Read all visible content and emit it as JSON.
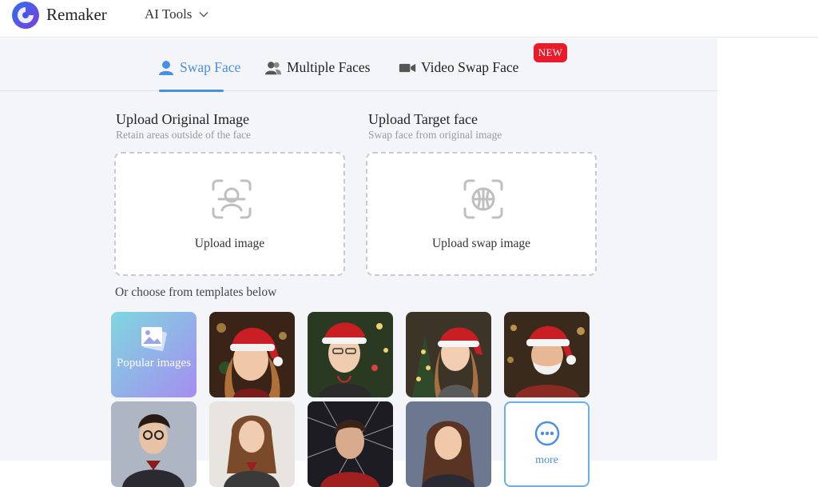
{
  "header": {
    "brand": "Remaker",
    "menu_label": "AI Tools"
  },
  "tabs": [
    {
      "label": "Swap Face",
      "active": true
    },
    {
      "label": "Multiple Faces",
      "active": false
    },
    {
      "label": "Video Swap Face",
      "active": false,
      "badge": "NEW"
    }
  ],
  "original": {
    "title": "Upload Original Image",
    "subtitle": "Retain areas outside of the face",
    "upload_label": "Upload image"
  },
  "target": {
    "title": "Upload Target face",
    "subtitle": "Swap face from original image",
    "upload_label": "Upload swap image"
  },
  "templates": {
    "heading": "Or choose from templates below",
    "popular_label": "Popular images",
    "more_label": "more"
  },
  "colors": {
    "accent": "#4a90e2",
    "badge": "#ea1b2a",
    "panel_bg": "#f3f5f8"
  }
}
